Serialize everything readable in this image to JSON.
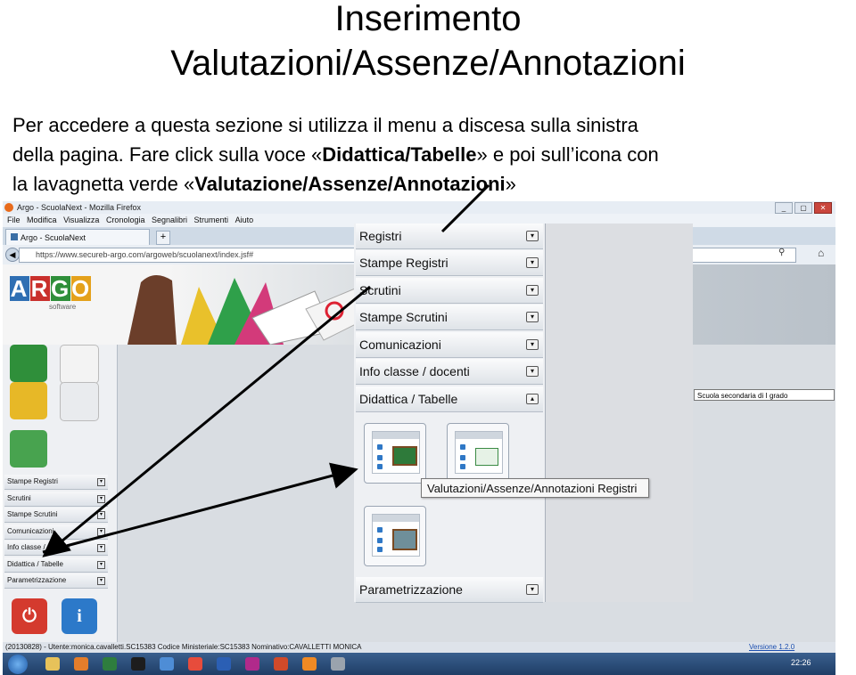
{
  "slide": {
    "title_line1": "Inserimento",
    "title_line2": "Valutazioni/Assenze/Annotazioni",
    "line1": "Per accedere a questa sezione si utilizza il menu a discesa sulla sinistra",
    "line2_a": "della pagina. Fare click sulla voce «",
    "line2_bold": "Didattica/Tabelle",
    "line2_b": "» e poi sull’icona con",
    "line3_a": "la lavagnetta verde «",
    "line3_bold": "Valutazione/Assenze/Annotazioni",
    "line3_b": "»"
  },
  "browser": {
    "window_title": "Argo - ScuolaNext - Mozilla Firefox",
    "menus": [
      "File",
      "Modifica",
      "Visualizza",
      "Cronologia",
      "Segnalibri",
      "Strumenti",
      "Aiuto"
    ],
    "tab_label": "Argo - ScuolaNext",
    "new_tab": "+",
    "url": "https://www.secureb-argo.com/argoweb/scuolanext/index.jsf#",
    "school_select": "Scuola secondaria di I grado",
    "logo_letters": [
      "A",
      "R",
      "G",
      "O"
    ],
    "logo_sub": "software"
  },
  "left_menu": {
    "items": [
      "Stampe Registri",
      "Scrutini",
      "Stampe Scrutini",
      "Comunicazioni",
      "Info classe / docenti",
      "Didattica / Tabelle",
      "Parametrizzazione"
    ]
  },
  "zoom_menu": {
    "items": [
      "Registri",
      "Stampe Registri",
      "Scrutini",
      "Stampe Scrutini",
      "Comunicazioni",
      "Info classe / docenti",
      "Didattica / Tabelle"
    ],
    "bottom_item": "Parametrizzazione",
    "tooltip": "Valutazioni/Assenze/Annotazioni Registri"
  },
  "status": {
    "text": "(20130828) - Utente:monica.cavalletti.SC15383 Codice Ministeriale:SC15383 Nominativo:CAVALLETTI MONICA",
    "version": "Versione 1.2.0",
    "clock": "22:26"
  },
  "colors": {
    "arrow": "#000000",
    "argo_blue": "#2f6fb3",
    "argo_red": "#c9302c",
    "argo_green": "#2f8f3a",
    "argo_orange": "#e4a11b"
  }
}
